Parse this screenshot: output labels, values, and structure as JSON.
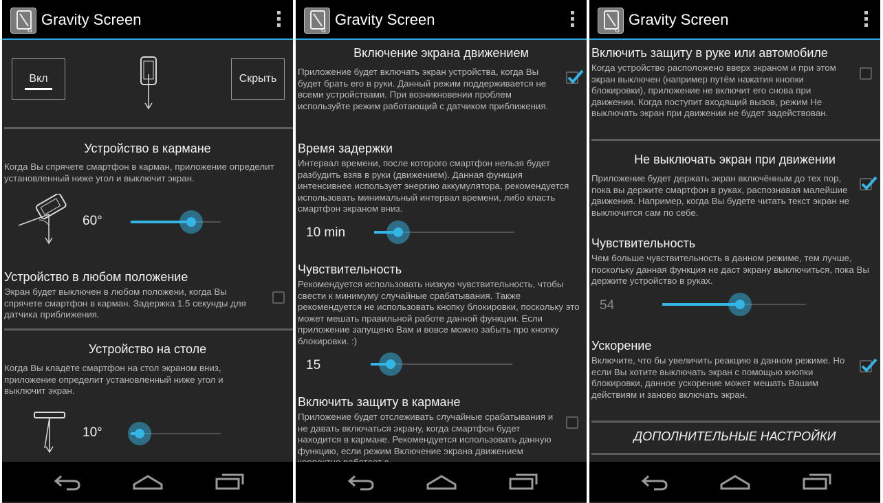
{
  "app": {
    "title": "Gravity Screen",
    "app_icon": "gravity-screen-logo-icon",
    "overflow_icon": "overflow-menu-icon"
  },
  "navbar": {
    "icons": [
      "back-icon",
      "home-icon",
      "recents-icon"
    ]
  },
  "colors": {
    "accent": "#33b5e5",
    "background": "#262626",
    "bar": "#000000"
  },
  "screen1": {
    "toggle_on_label": "Вкл",
    "hide_label": "Скрыть",
    "pocket": {
      "title": "Устройство в кармане",
      "summary": "Когда Вы спрячете смартфон в карман, приложение определит установленный ниже угол и выключит экран.",
      "value": "60°",
      "level": 0.67
    },
    "any_position": {
      "title": "Устройство в любом положение",
      "summary": "Экран будет выключен в любом положени, когда Вы спрячете смартфон в карман. Задержка 1.5 секунды для датчика приближения.",
      "checked": false
    },
    "table": {
      "title": "Устройство на столе",
      "summary": "Когда Вы кладёте смартфон на стол экраном вниз, приложение определит установленный ниже угол и выключит экран.",
      "value": "10°",
      "level": 0.1
    }
  },
  "screen2": {
    "motion_wake": {
      "title": "Включение экрана движением",
      "summary": "Приложение будет включать экран устройства, когда Вы будет брать его в руки. Данный режим поддерживается не всеми устройствами. При возникновении проблем используйте режим работающий с датчиком приближения.",
      "checked": true
    },
    "delay": {
      "title": "Время задержки",
      "summary": "Интервал времени, после которого смартфон нельзя будет разбудить взяв в руки (движением). Данная функция интенсивнее использует энергию аккумулятора, рекомендуется использовать минимальный интервал времени, либо класть смартфон экраном вниз.",
      "value": "10 min",
      "level": 0.17
    },
    "sensitivity": {
      "title": "Чувствительность",
      "summary": "Рекомендуется использовать низкую чувствительность, чтобы свести к минимуму случайные срабатывания. Также рекомендуется не использовать кнопку блокировки, поскольку это может мешать правильной работе данной функции. Если приложение запущено Вам и вовсе можно забыть про кнопку блокировки. :)",
      "value": "15",
      "level": 0.14
    },
    "pocket_protection": {
      "title": "Включить защиту в кармане",
      "summary": "Приложение будет отслеживать случайные срабатывания и не давать включаться экрану, когда смартфон будет находится в кармане. Рекомендуется использовать данную функцию, если режим Включение экрана движением корректно работает с",
      "checked": false
    }
  },
  "screen3": {
    "hand_car": {
      "title": "Включить защиту в руке или автомобиле",
      "summary": "Когда устройство расположено вверх экраном и при этом экран выключен (например путём нажатия кнопки блокировки), приложение не включит его снова при движении. Когда поступит входящий вызов, режим Не выключать экран при движении не будет задействован.",
      "checked": false
    },
    "keep_on": {
      "title": "Не выключать экран при движении",
      "summary": "Приложение будет держать экран включённым до тех пор, пока вы держите смартфон в руках, распознавая малейшие движения. Например, когда Вы будете читать текст экран не выключится сам по себе.",
      "checked": true
    },
    "sensitivity": {
      "title": "Чувствительность",
      "summary": "Чем больше чувствительность в данном режиме, тем лучше, поскольку данная функция не даст экрану выключиться, пока Вы держите устройство в руках.",
      "value": "54",
      "level": 0.54
    },
    "acceleration": {
      "title": "Ускорение",
      "summary": "Включите, что бы увеличить реакцию в данном режиме. Но если Вы хотите выключать экран с помощью кнопки блокировки, данное ускорение может мешать Вашим действиям и заново включать экран.",
      "checked": true
    },
    "advanced_header": "ДОПОЛНИТЕЛЬНЫЕ НАСТРОЙКИ"
  }
}
